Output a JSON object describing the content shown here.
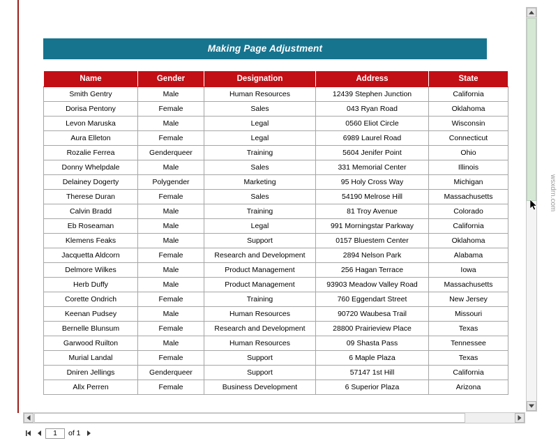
{
  "document": {
    "title": "Making Page Adjustment",
    "columns": [
      "Name",
      "Gender",
      "Designation",
      "Address",
      "State"
    ],
    "rows": [
      [
        "Smith Gentry",
        "Male",
        "Human Resources",
        "12439 Stephen Junction",
        "California"
      ],
      [
        "Dorisa Pentony",
        "Female",
        "Sales",
        "043 Ryan Road",
        "Oklahoma"
      ],
      [
        "Levon Maruska",
        "Male",
        "Legal",
        "0560 Eliot Circle",
        "Wisconsin"
      ],
      [
        "Aura Elleton",
        "Female",
        "Legal",
        "6989 Laurel Road",
        "Connecticut"
      ],
      [
        "Rozalie Ferrea",
        "Genderqueer",
        "Training",
        "5604 Jenifer Point",
        "Ohio"
      ],
      [
        "Donny Whelpdale",
        "Male",
        "Sales",
        "331 Memorial Center",
        "Illinois"
      ],
      [
        "Delainey Dogerty",
        "Polygender",
        "Marketing",
        "95 Holy Cross Way",
        "Michigan"
      ],
      [
        "Therese Duran",
        "Female",
        "Sales",
        "54190 Melrose Hill",
        "Massachusetts"
      ],
      [
        "Calvin Bradd",
        "Male",
        "Training",
        "81 Troy Avenue",
        "Colorado"
      ],
      [
        "Eb Roseaman",
        "Male",
        "Legal",
        "991 Morningstar Parkway",
        "California"
      ],
      [
        "Klemens Feaks",
        "Male",
        "Support",
        "0157 Bluestem Center",
        "Oklahoma"
      ],
      [
        "Jacquetta Aldcorn",
        "Female",
        "Research and Development",
        "2894 Nelson Park",
        "Alabama"
      ],
      [
        "Delmore Wilkes",
        "Male",
        "Product Management",
        "256 Hagan Terrace",
        "Iowa"
      ],
      [
        "Herb Duffy",
        "Male",
        "Product Management",
        "93903 Meadow Valley Road",
        "Massachusetts"
      ],
      [
        "Corette Ondrich",
        "Female",
        "Training",
        "760 Eggendart Street",
        "New Jersey"
      ],
      [
        "Keenan Pudsey",
        "Male",
        "Human Resources",
        "90720 Waubesa Trail",
        "Missouri"
      ],
      [
        "Bernelle Blunsum",
        "Female",
        "Research and Development",
        "28800 Prairieview Place",
        "Texas"
      ],
      [
        "Garwood Ruilton",
        "Male",
        "Human Resources",
        "09 Shasta Pass",
        "Tennessee"
      ],
      [
        "Murial Landal",
        "Female",
        "Support",
        "6 Maple Plaza",
        "Texas"
      ],
      [
        "Dniren Jellings",
        "Genderqueer",
        "Support",
        "57147 1st Hill",
        "California"
      ],
      [
        "Allx Perren",
        "Female",
        "Business Development",
        "6 Superior Plaza",
        "Arizona"
      ]
    ]
  },
  "pager": {
    "page_value": "1",
    "of_label": "of 1"
  },
  "watermark": {
    "text": "wsxdrn.com"
  },
  "colors": {
    "title_bar": "#17748f",
    "header_row": "#c10f15",
    "frame_accent": "#9c1c18",
    "scroll_thumb": "#d4e8d4"
  }
}
